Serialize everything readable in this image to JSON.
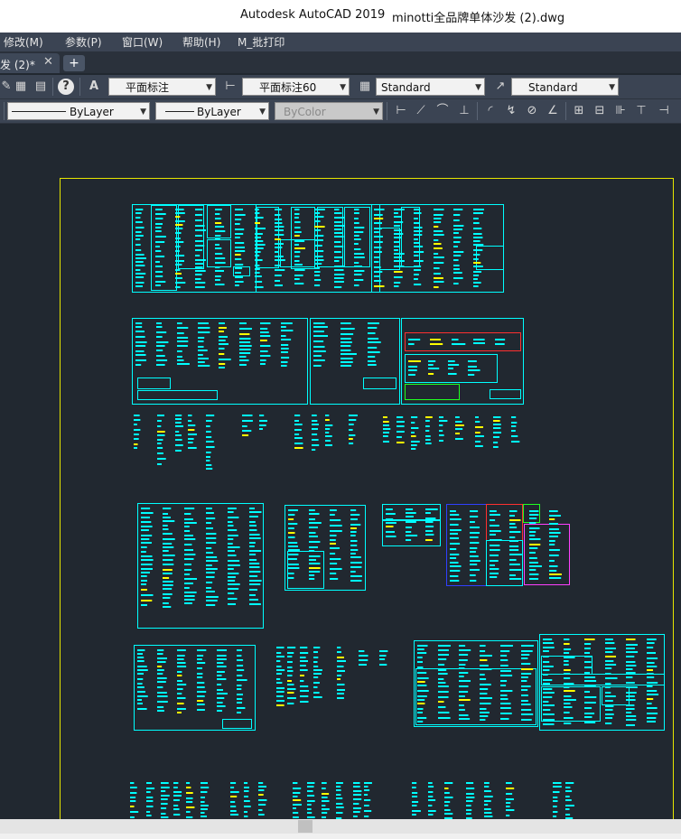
{
  "window": {
    "app_title": "Autodesk AutoCAD 2019",
    "file_title": "minotti全品牌单体沙发 (2).dwg"
  },
  "menu": {
    "items": [
      "修改(M)",
      "参数(P)",
      "窗口(W)",
      "帮助(H)",
      "M_批打印"
    ]
  },
  "tabs": {
    "active_label": "发 (2)*",
    "close_glyph": "✕",
    "add_glyph": "+"
  },
  "toolbar1": {
    "text_style": "平面标注",
    "dim_style": "平面标注60",
    "table_style": "Standard",
    "mleader_style": "Standard"
  },
  "toolbar2": {
    "linetype": "ByLayer",
    "lineweight": "ByLayer",
    "plotstyle": "ByColor"
  },
  "drawing": {
    "frame_color": "#e6e600",
    "line_color": "#00ffff",
    "accent_colors": [
      "#ff3030",
      "#3040ff",
      "#20ff20",
      "#ff40ff",
      "#ffff00"
    ]
  }
}
